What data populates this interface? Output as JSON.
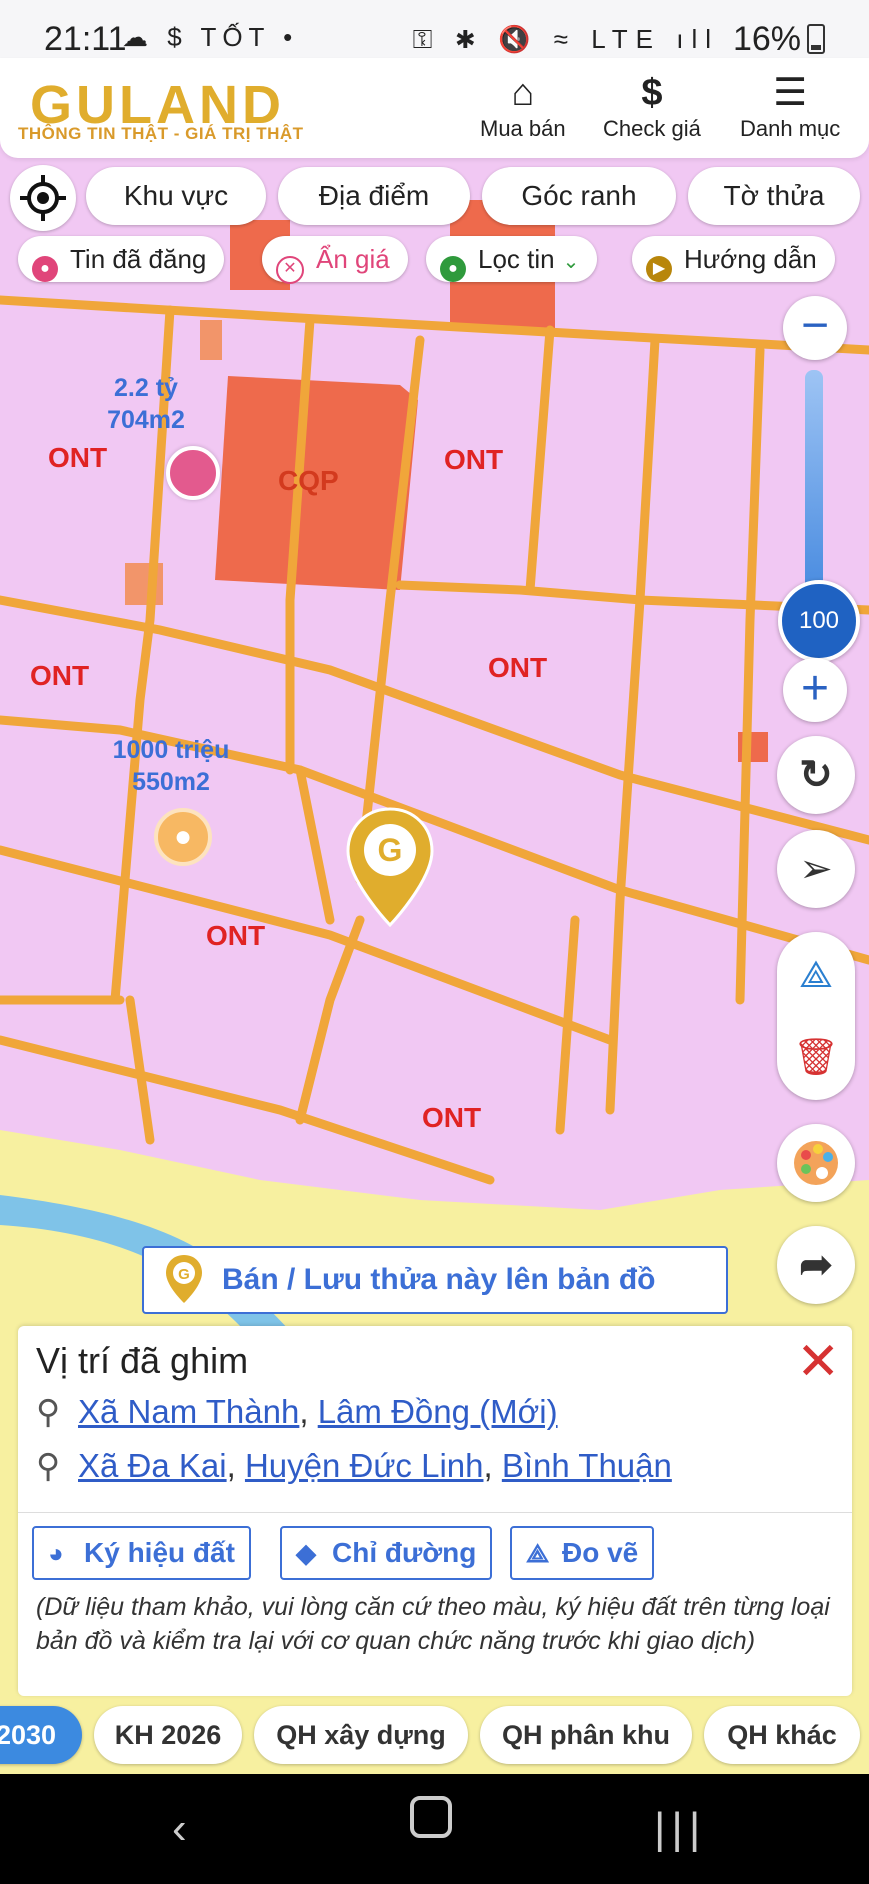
{
  "status_bar": {
    "time": "21:11",
    "left_icons": "☁ $ TỐT •",
    "right_icons": "⚿ ✱ 🔇 ≈ LTE ıll",
    "battery": "16%"
  },
  "header": {
    "logo": "GULAND",
    "tagline": "THÔNG TIN THẬT - GIÁ TRỊ THẬT",
    "buttons": [
      {
        "label": "Mua bán",
        "icon": "house-icon"
      },
      {
        "label": "Check giá",
        "icon": "dollar-icon"
      },
      {
        "label": "Danh mục",
        "icon": "menu-icon"
      }
    ]
  },
  "filter_chips": [
    "Khu vực",
    "Địa điểm",
    "Góc ranh",
    "Tờ thửa"
  ],
  "tool_chips": [
    {
      "label": "Tin đã đăng",
      "color": "#e0457a"
    },
    {
      "label": "Ẩn giá",
      "color": "#e0457a"
    },
    {
      "label": "Lọc tin",
      "color": "#2f9a3c"
    },
    {
      "label": "Hướng dẫn",
      "color": "#b8860b"
    }
  ],
  "map": {
    "zone_labels": [
      "ONT",
      "CQP",
      "ONT",
      "ONT",
      "ONT",
      "ONT",
      "ONT"
    ],
    "listings": [
      {
        "price": "2.2 tỷ",
        "area": "704m2"
      },
      {
        "price": "1000 triệu",
        "area": "550m2"
      }
    ],
    "zoom_level": "100",
    "colors": {
      "residential": "#f1c8f3",
      "road": "#f0a63a",
      "defense": "#ee6a4c",
      "water": "#7fc3e8",
      "agri": "#f7f0a0"
    }
  },
  "sell_button": "Bán / Lưu thửa này lên bản đồ",
  "panel": {
    "title": "Vị trí đã ghim",
    "new_address": {
      "parts": [
        "Xã Nam Thành",
        "Lâm Đồng (Mới)"
      ]
    },
    "old_address": {
      "parts": [
        "Xã Đa Kai",
        "Huyện Đức Linh",
        "Bình Thuận"
      ]
    },
    "actions": [
      "Ký hiệu đất",
      "Chỉ đường",
      "Đo vẽ"
    ],
    "note": "(Dữ liệu tham khảo, vui lòng căn cứ theo màu, ký hiệu đất trên từng loại bản đồ và kiểm tra lại với cơ quan chức năng trước khi giao dịch)"
  },
  "bottom_chips": [
    "2030",
    "KH 2026",
    "QH xây dựng",
    "QH phân khu",
    "QH khác"
  ]
}
